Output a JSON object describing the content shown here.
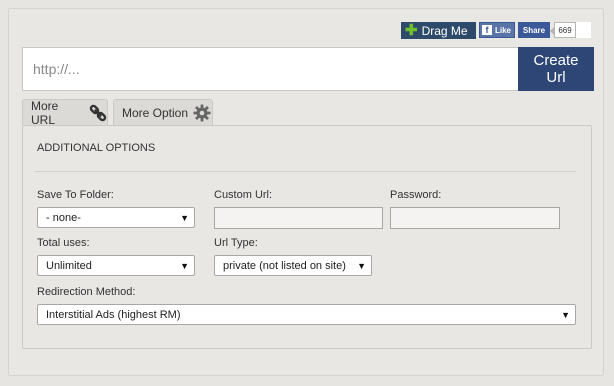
{
  "social": {
    "drag_label": "Drag Me",
    "like_label": "Like",
    "share_label": "Share",
    "share_count": "669"
  },
  "url_bar": {
    "placeholder": "http://...",
    "value": "",
    "create_label": "Create Url"
  },
  "tabs": [
    {
      "label": "More URL",
      "icon": "chain-link-icon"
    },
    {
      "label": "More Option",
      "icon": "gear-icon"
    }
  ],
  "options": {
    "title": "ADDITIONAL OPTIONS",
    "save_folder": {
      "label": "Save To Folder:",
      "value": "- none-"
    },
    "custom_url": {
      "label": "Custom Url:",
      "value": ""
    },
    "password": {
      "label": "Password:",
      "value": ""
    },
    "total_uses": {
      "label": "Total uses:",
      "value": "Unlimited"
    },
    "url_type": {
      "label": "Url Type:",
      "value": "private (not listed on site)"
    },
    "redirection": {
      "label": "Redirection Method:",
      "value": "Interstitial Ads (highest RM)"
    }
  },
  "colors": {
    "create_button": "#2d4676",
    "drag_button": "#2d4a6a",
    "facebook": "#3b5998"
  }
}
